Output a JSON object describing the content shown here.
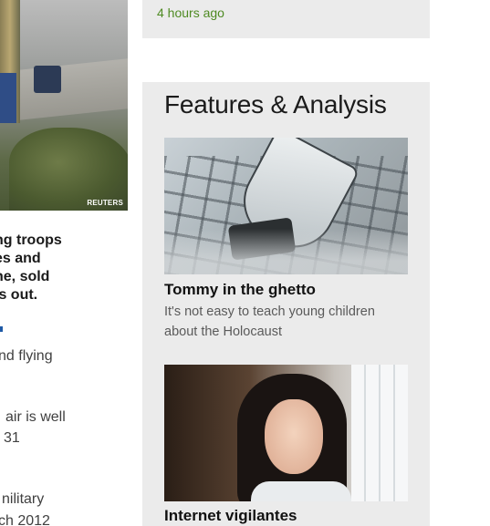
{
  "lead_story": {
    "photo_credit": "REUTERS",
    "headline_lines": [
      "ng troops",
      "es and",
      "he, sold",
      "ls out."
    ],
    "body_fragments": [
      "nd flying",
      "air is well",
      "31",
      "nilitary",
      "ch 2012"
    ]
  },
  "top_box": {
    "timestamp": "4 hours ago"
  },
  "features": {
    "heading": "Features & Analysis",
    "items": [
      {
        "title": "Tommy in the ghetto",
        "summary": "It's not easy to teach young children about the Holocaust"
      },
      {
        "title": "Internet vigilantes"
      }
    ]
  },
  "colors": {
    "panel_background": "#ebebeb",
    "timestamp_green": "#4e8a22",
    "link_blue": "#1f5aa6"
  }
}
